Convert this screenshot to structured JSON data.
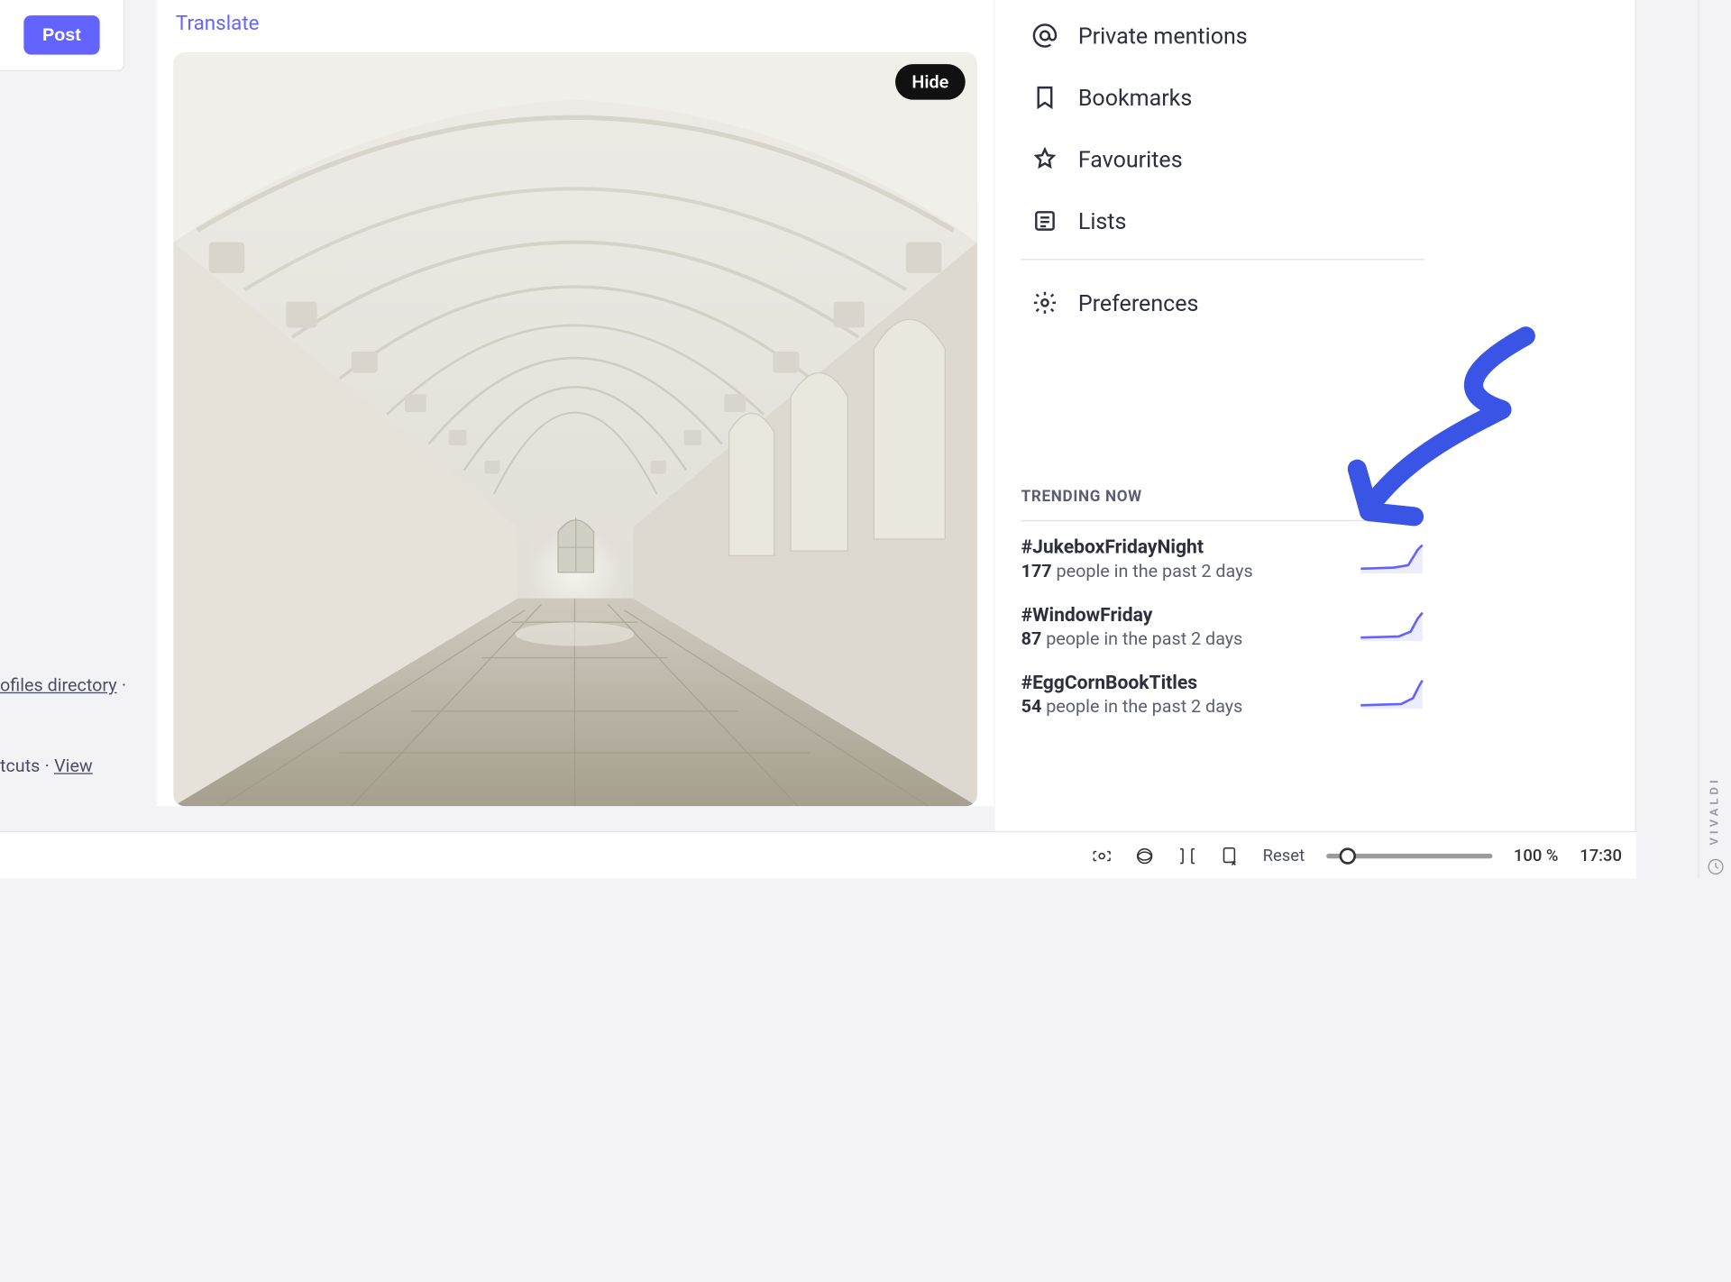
{
  "compose": {
    "post_label": "Post"
  },
  "post": {
    "translate_label": "Translate",
    "hide_label": "Hide"
  },
  "nav": {
    "private_mentions": "Private mentions",
    "bookmarks": "Bookmarks",
    "favourites": "Favourites",
    "lists": "Lists",
    "preferences": "Preferences"
  },
  "trending": {
    "title": "TRENDING NOW",
    "items": [
      {
        "tag": "#JukeboxFridayNight",
        "count": "177",
        "sub": "people in the past 2 days"
      },
      {
        "tag": "#WindowFriday",
        "count": "87",
        "sub": "people in the past 2 days"
      },
      {
        "tag": "#EggCornBookTitles",
        "count": "54",
        "sub": "people in the past 2 days"
      }
    ]
  },
  "footer_links": {
    "profiles_directory": "ofiles directory",
    "shortcuts": "tcuts",
    "view": "View"
  },
  "bottombar": {
    "reset": "Reset",
    "zoom": "100 %",
    "time": "17:30"
  },
  "vivaldi": {
    "label": "VIVALDI"
  },
  "colors": {
    "accent": "#6364ff",
    "arrow": "#3a55e6"
  }
}
